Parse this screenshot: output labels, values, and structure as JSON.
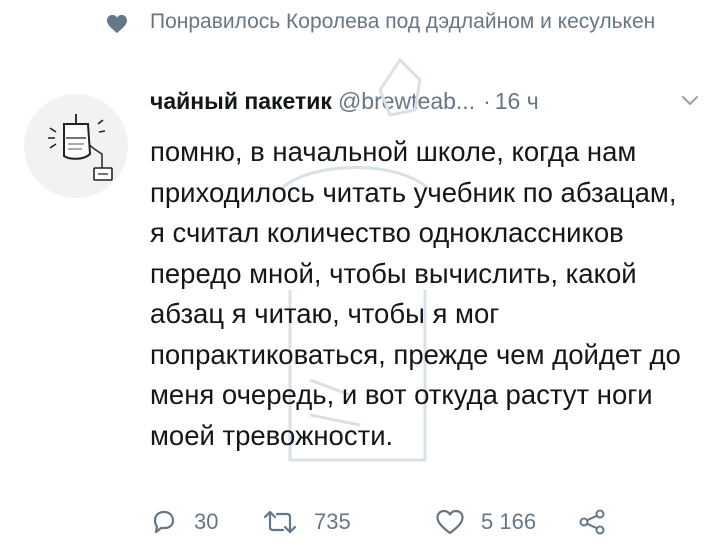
{
  "social_context": {
    "text": "Понравилось Королева под дэдлайном и кесулькен"
  },
  "tweet": {
    "display_name": "чайный пакетик",
    "handle": "@brewteab...",
    "separator": "·",
    "time": "16 ч",
    "text": "помню, в начальной школе, когда нам приходилось читать учебник по абзацам, я считал количество одноклассников передо мной, чтобы вычислить, какой абзац я читаю, чтобы я мог попрактиковаться, прежде чем дойдет до меня очередь, и вот откуда растут ноги моей тревожности.",
    "replies": "30",
    "retweets": "735",
    "likes": "5 166"
  },
  "colors": {
    "text": "#14171a",
    "secondary": "#657786",
    "watermark": "#d9e1e8"
  },
  "icons": [
    "heart-icon",
    "avatar-tea-bag",
    "chevron-down-icon",
    "reply-icon",
    "retweet-icon",
    "like-icon",
    "share-icon"
  ]
}
